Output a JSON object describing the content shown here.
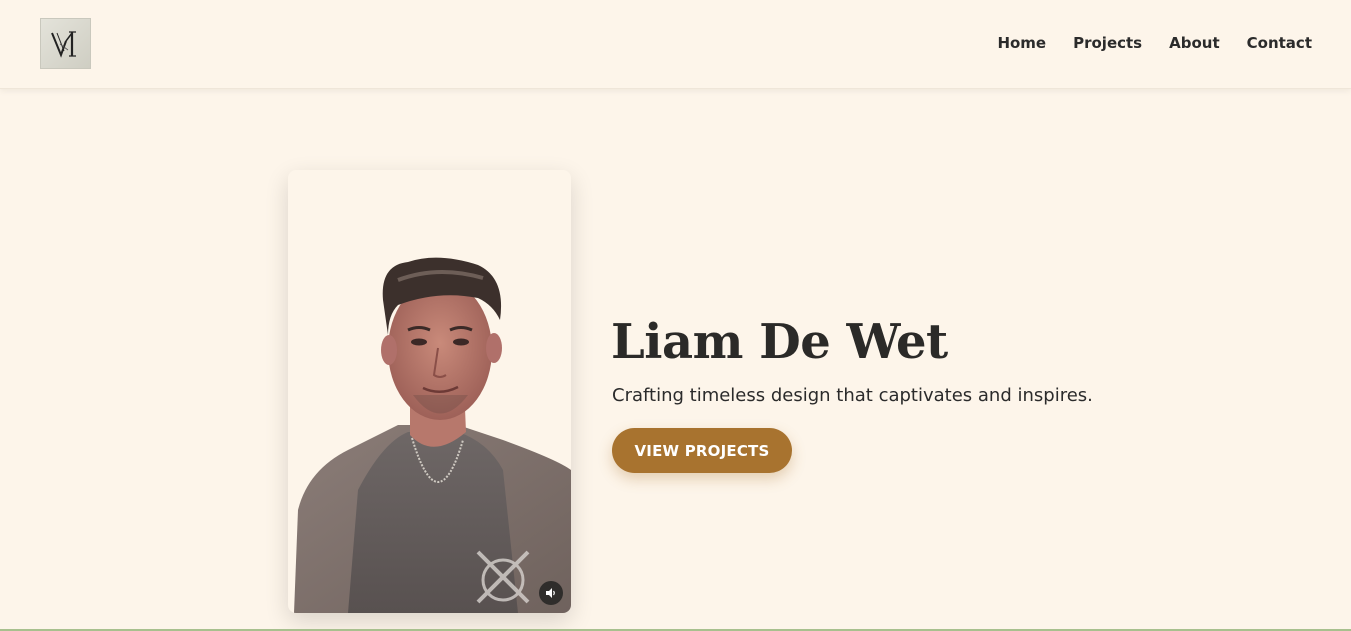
{
  "header": {
    "logo_text": "VI",
    "nav": [
      {
        "label": "Home"
      },
      {
        "label": "Projects"
      },
      {
        "label": "About"
      },
      {
        "label": "Contact"
      }
    ]
  },
  "hero": {
    "name": "Liam De Wet",
    "tagline": "Crafting timeless design that captivates and inspires.",
    "cta_label": "VIEW PROJECTS",
    "photo_alt": "Portrait of Liam De Wet",
    "sound_icon": "speaker-icon"
  },
  "colors": {
    "background": "#fdf5ea",
    "accent": "#a8732f",
    "text": "#2b2b2b"
  }
}
